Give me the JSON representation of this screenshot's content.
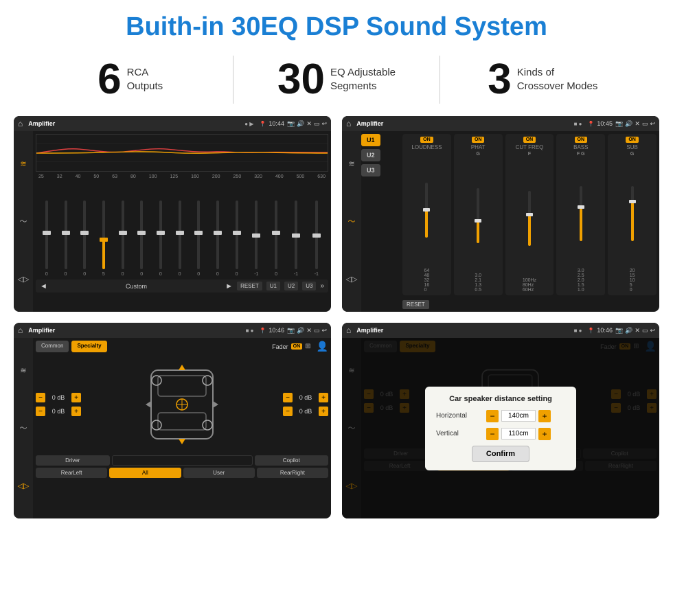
{
  "header": {
    "title": "Buith-in 30EQ DSP Sound System"
  },
  "stats": [
    {
      "number": "6",
      "label": "RCA\nOutputs"
    },
    {
      "number": "30",
      "label": "EQ Adjustable\nSegments"
    },
    {
      "number": "3",
      "label": "Kinds of\nCrossover Modes"
    }
  ],
  "screens": [
    {
      "id": "eq-screen",
      "topbar": {
        "title": "Amplifier",
        "time": "10:44"
      },
      "freq_labels": [
        "25",
        "32",
        "40",
        "50",
        "63",
        "80",
        "100",
        "125",
        "160",
        "200",
        "250",
        "320",
        "400",
        "500",
        "630"
      ],
      "eq_values": [
        "0",
        "0",
        "0",
        "5",
        "0",
        "0",
        "0",
        "0",
        "0",
        "0",
        "0",
        "-1",
        "0",
        "-1"
      ],
      "playback": {
        "label": "Custom",
        "buttons": [
          "RESET",
          "U1",
          "U2",
          "U3"
        ]
      }
    },
    {
      "id": "crossover-screen",
      "topbar": {
        "title": "Amplifier",
        "time": "10:45"
      },
      "u_buttons": [
        "U1",
        "U2",
        "U3"
      ],
      "channels": [
        {
          "label": "LOUDNESS",
          "on": true
        },
        {
          "label": "PHAT",
          "on": true
        },
        {
          "label": "CUT FREQ",
          "on": true
        },
        {
          "label": "BASS",
          "on": true
        },
        {
          "label": "SUB",
          "on": true
        }
      ],
      "reset_label": "RESET"
    },
    {
      "id": "speaker-screen",
      "topbar": {
        "title": "Amplifier",
        "time": "10:46"
      },
      "tabs": [
        "Common",
        "Specialty"
      ],
      "active_tab": 1,
      "fader_label": "Fader",
      "fader_on": true,
      "db_values": [
        "0 dB",
        "0 dB",
        "0 dB",
        "0 dB"
      ],
      "buttons": [
        "Driver",
        "",
        "Copilot",
        "RearLeft",
        "All",
        "User",
        "RearRight"
      ]
    },
    {
      "id": "dialog-screen",
      "topbar": {
        "title": "Amplifier",
        "time": "10:46"
      },
      "tabs": [
        "Common",
        "Specialty"
      ],
      "active_tab": 1,
      "dialog": {
        "title": "Car speaker distance setting",
        "horizontal_label": "Horizontal",
        "horizontal_value": "140cm",
        "vertical_label": "Vertical",
        "vertical_value": "110cm",
        "confirm_label": "Confirm"
      },
      "buttons": [
        "Driver",
        "",
        "Copilot",
        "RearLeft",
        "All",
        "User",
        "RearRight"
      ],
      "db_values": [
        "0 dB",
        "0 dB"
      ]
    }
  ]
}
